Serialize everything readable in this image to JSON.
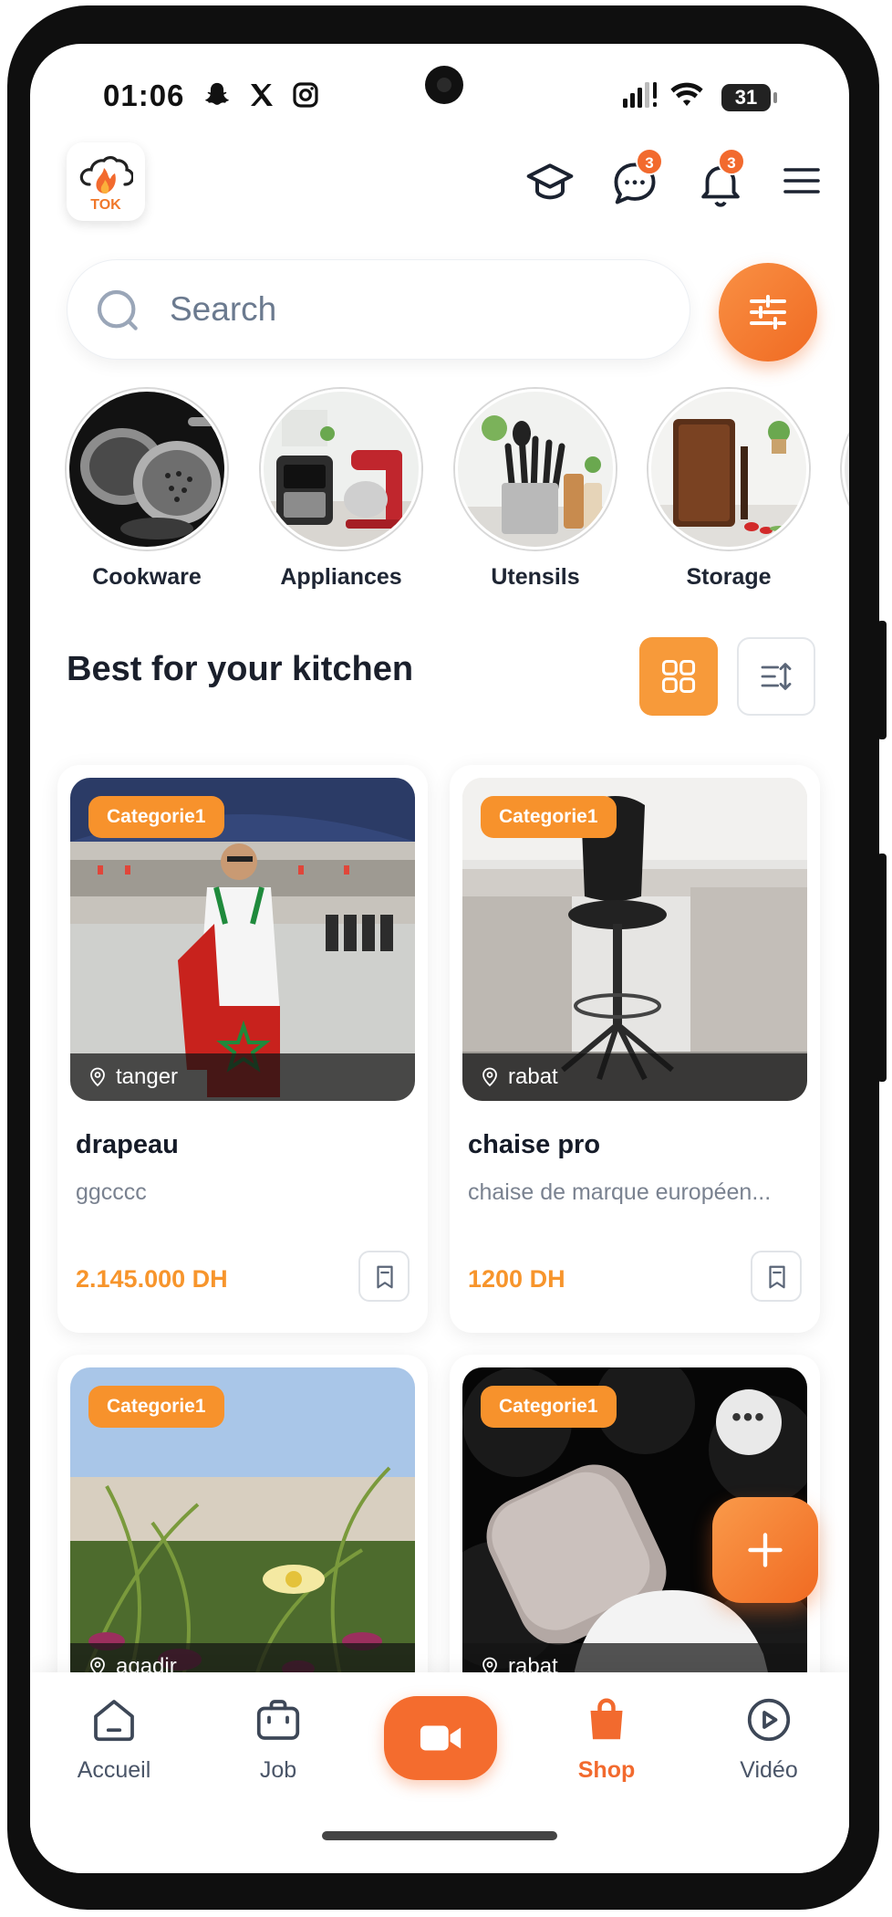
{
  "status_bar": {
    "time": "01:06",
    "battery": "31"
  },
  "header": {
    "logo_text": "TOK",
    "messages_badge": "3",
    "notifications_badge": "3"
  },
  "search": {
    "placeholder": "Search"
  },
  "categories": [
    {
      "label": "Cookware"
    },
    {
      "label": "Appliances"
    },
    {
      "label": "Utensils"
    },
    {
      "label": "Storage"
    }
  ],
  "section": {
    "title": "Best for your kitchen"
  },
  "products": [
    {
      "category": "Categorie1",
      "location": "tanger",
      "title": "drapeau",
      "description": "ggcccc",
      "price": "2.145.000 DH"
    },
    {
      "category": "Categorie1",
      "location": "rabat",
      "title": "chaise pro",
      "description": "chaise de marque européen...",
      "price": "1200 DH"
    },
    {
      "category": "Categorie1",
      "location": "agadir"
    },
    {
      "category": "Categorie1",
      "location": "rabat",
      "more": "•••"
    }
  ],
  "bottom_nav": {
    "items": [
      {
        "label": "Accueil"
      },
      {
        "label": "Job"
      },
      {
        "label": "Shop"
      },
      {
        "label": "Vidéo"
      }
    ],
    "active": "Shop"
  },
  "colors": {
    "accent": "#f7922c",
    "accent_dark": "#f26a2e"
  }
}
